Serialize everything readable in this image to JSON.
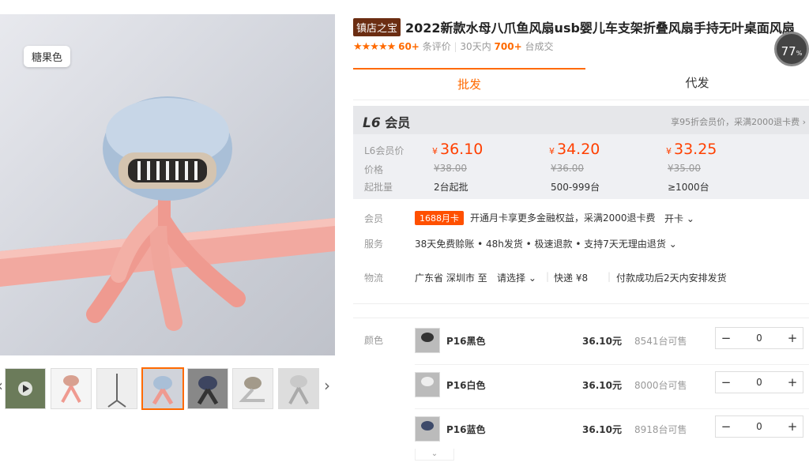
{
  "gallery": {
    "main_badge": "糖果色",
    "thumbs_count": 7
  },
  "product": {
    "shop_badge": "镇店之宝",
    "title": "2022新款水母八爪鱼风扇usb婴儿车支架折叠风扇手持无叶桌面风扇",
    "stars": "★★★★★",
    "reviews_count": "60+",
    "reviews_label": "条评价",
    "days_label": "30天内",
    "sold_count": "700+",
    "sold_label": "台成交",
    "progress_value": "77",
    "progress_unit": "%"
  },
  "tabs": [
    {
      "label": "批发",
      "active": true
    },
    {
      "label": "代发",
      "active": false
    }
  ],
  "vip": {
    "level": "L6",
    "level_text": "会员",
    "note": "享95折会员价，采满2000退卡费 ›",
    "labels": {
      "vip_price": "L6会员价",
      "price": "价格",
      "moq": "起批量"
    },
    "currency": "¥",
    "tiers": [
      {
        "vip_price": "36.10",
        "orig_price": "¥38.00",
        "qty": "2台起批"
      },
      {
        "vip_price": "34.20",
        "orig_price": "¥36.00",
        "qty": "500-999台"
      },
      {
        "vip_price": "33.25",
        "orig_price": "¥35.00",
        "qty": "≥1000台"
      }
    ]
  },
  "info": {
    "member_label": "会员",
    "card_badge": "1688月卡",
    "card_text": "开通月卡享更多金融权益，采满2000退卡费",
    "card_link": "开卡 ⌄",
    "service_label": "服务",
    "service_text": "38天免费赊账 • 48h发货 • 极速退款 • 支持7天无理由退货 ⌄",
    "logistics_label": "物流",
    "from_text": "广东省  深圳市   至",
    "dest_select": "请选择 ⌄",
    "express_text": "快递  ¥8",
    "ship_text": "付款成功后2天内安排发货"
  },
  "sku": {
    "color_label": "颜色",
    "items": [
      {
        "name": "P16黑色",
        "price": "36.10元",
        "stock": "8541台可售",
        "qty": "0"
      },
      {
        "name": "P16白色",
        "price": "36.10元",
        "stock": "8000台可售",
        "qty": "0"
      },
      {
        "name": "P16蓝色",
        "price": "36.10元",
        "stock": "8918台可售",
        "qty": "0"
      }
    ],
    "minus": "−",
    "plus": "+",
    "more_icon": "chevron-down-icon"
  }
}
